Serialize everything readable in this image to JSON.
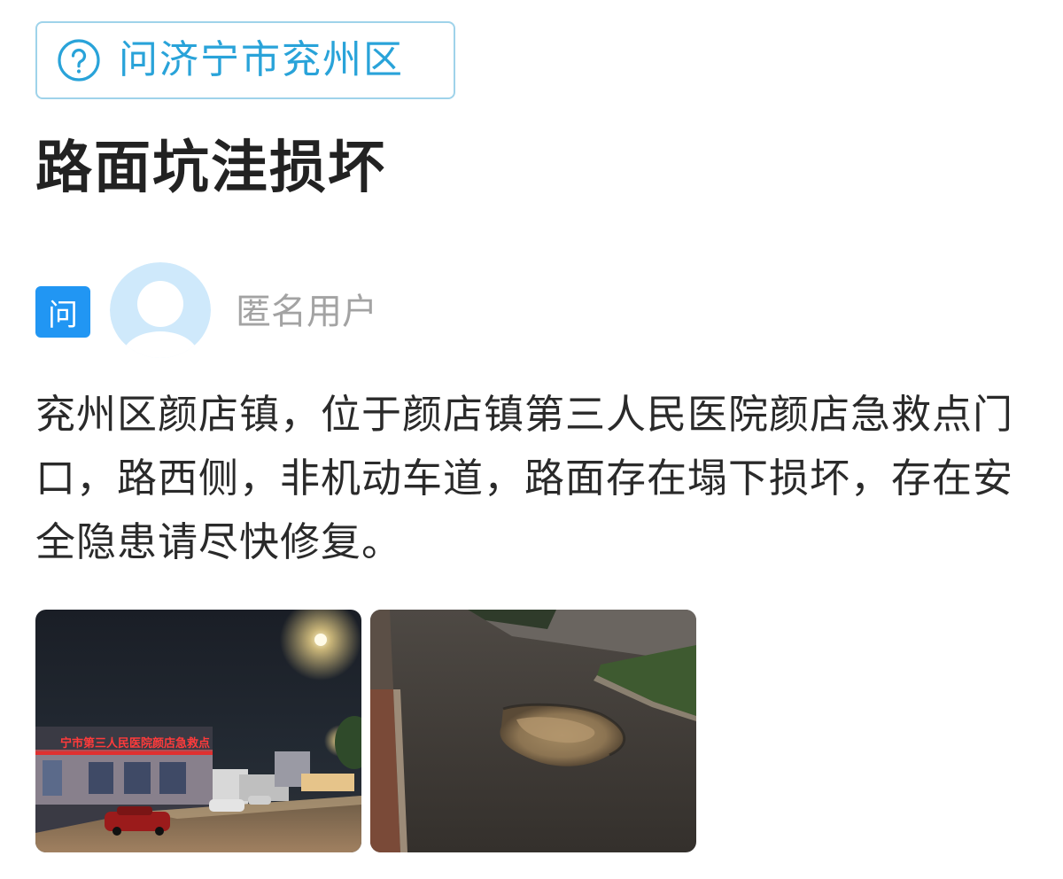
{
  "tag": {
    "label": "问济宁市兖州区",
    "icon": "question-circle-icon"
  },
  "post": {
    "title": "路面坑洼损坏",
    "type_badge": "问",
    "author": "匿名用户",
    "body": "兖州区颜店镇，位于颜店镇第三人民医院颜店急救点门口，路西侧，非机动车道，路面存在塌下损坏，存在安全隐患请尽快修复。",
    "photos": [
      {
        "sign_text": "宁市第三人民医院颜店急救点"
      },
      {}
    ]
  },
  "colors": {
    "accent": "#29a3d9",
    "badge": "#2196f3",
    "muted": "#a3a3a3",
    "text": "#2a2a2a"
  }
}
